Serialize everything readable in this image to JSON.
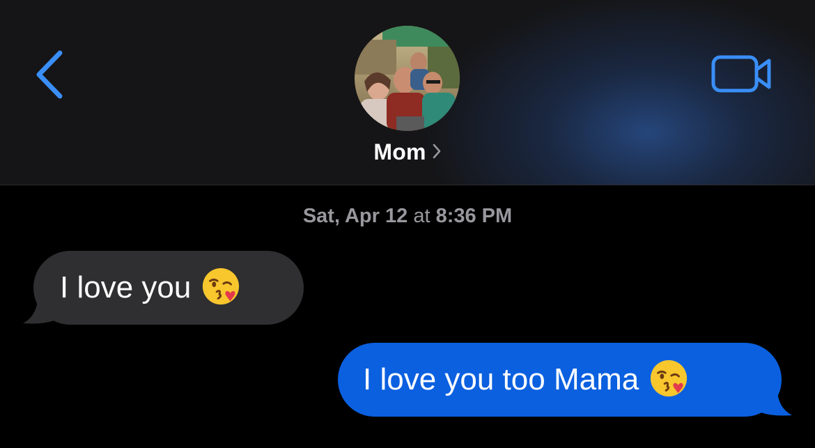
{
  "header": {
    "contact_name": "Mom",
    "back_icon": "chevron-left-icon",
    "video_icon": "video-camera-icon",
    "chevron_icon": "chevron-right-icon",
    "accent_color": "#3a8ef6"
  },
  "conversation": {
    "timestamp_date": "Sat, Apr 12",
    "timestamp_at": "at",
    "timestamp_time": "8:36 PM",
    "messages": [
      {
        "direction": "incoming",
        "text": "I love you",
        "emoji": "kissing-heart-emoji",
        "bubble_color": "#2f2f31"
      },
      {
        "direction": "outgoing",
        "text": "I love you too Mama",
        "emoji": "kissing-heart-emoji",
        "bubble_color": "#0b60e0"
      }
    ]
  }
}
